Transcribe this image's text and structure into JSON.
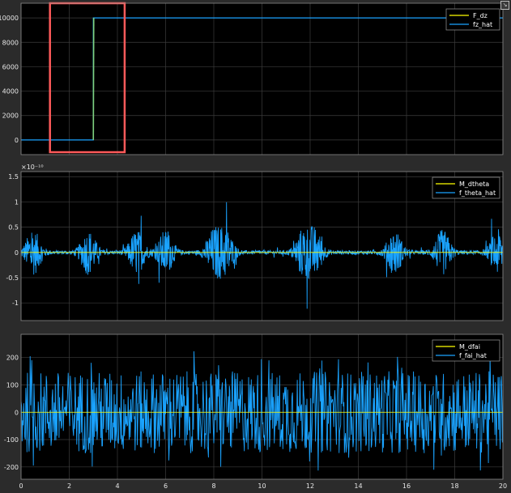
{
  "window": {
    "dock_icon": "dock-arrow-icon"
  },
  "colors": {
    "figure_bg": "#2b2b2b",
    "axes_bg": "#000000",
    "grid": "#3c3c3c",
    "axis_text": "#e6e6e6",
    "series_ref": "#ffff00",
    "series_hat": "#1aa3ff",
    "overlap_green": "#7fd27f",
    "highlight_box": "#ff5a5a"
  },
  "chart_data": [
    {
      "type": "line",
      "xlim": [
        0,
        20
      ],
      "ylim": [
        -1200,
        11200
      ],
      "yticks": [
        0,
        2000,
        4000,
        6000,
        8000,
        10000
      ],
      "yticklabels": [
        "0",
        "2000",
        "4000",
        "6000",
        "8000",
        "10000"
      ],
      "exponent_label": "",
      "grid": true,
      "legend_position": "top-right",
      "series": [
        {
          "name": "F_dz",
          "color": "#ffff00",
          "step": {
            "t": 3,
            "before": 0,
            "after": 10000
          }
        },
        {
          "name": "fz_hat",
          "color": "#1aa3ff",
          "step": {
            "t": 3,
            "before": 0,
            "after": 10000
          }
        }
      ],
      "annotation": {
        "type": "rectangle",
        "x_range": [
          1.2,
          4.3
        ],
        "y_range": [
          -1000,
          11200
        ],
        "color": "#ff5a5a"
      }
    },
    {
      "type": "line",
      "xlim": [
        0,
        20
      ],
      "ylim": [
        -1.35,
        1.6
      ],
      "yticks": [
        -1,
        -0.5,
        0,
        0.5,
        1,
        1.5
      ],
      "yticklabels": [
        "-1",
        "-0.5",
        "0",
        "0.5",
        "1",
        "1.5"
      ],
      "exponent_label": "×10⁻¹⁰",
      "grid": true,
      "legend_position": "top-right",
      "series": [
        {
          "name": "M_dtheta",
          "color": "#ffff00",
          "values": "constant 0"
        },
        {
          "name": "f_theta_hat",
          "color": "#1aa3ff",
          "values": "noise, amplitude mostly within ±0.5, peaks about ±1.2, bursts near t=0.5, 2.8, 4.8, 6, 8, 8.5, 11.7, 12.2, 15.5, 17.5, 19.8"
        }
      ]
    },
    {
      "type": "line",
      "xlim": [
        0,
        20
      ],
      "ylim": [
        -245,
        285
      ],
      "yticks": [
        -200,
        -100,
        0,
        100,
        200
      ],
      "yticklabels": [
        "-200",
        "-100",
        "0",
        "100",
        "200"
      ],
      "exponent_label": "",
      "grid": true,
      "legend_position": "top-right",
      "series": [
        {
          "name": "M_dfai",
          "color": "#ffff00",
          "values": "constant 0"
        },
        {
          "name": "f_fai_hat",
          "color": "#1aa3ff",
          "values": "noise, amplitude about ±150, peaks about ±230"
        }
      ]
    }
  ],
  "x_axis": {
    "ticks": [
      0,
      2,
      4,
      6,
      8,
      10,
      12,
      14,
      16,
      18,
      20
    ],
    "ticklabels": [
      "0",
      "2",
      "4",
      "6",
      "8",
      "10",
      "12",
      "14",
      "16",
      "18",
      "20"
    ]
  }
}
